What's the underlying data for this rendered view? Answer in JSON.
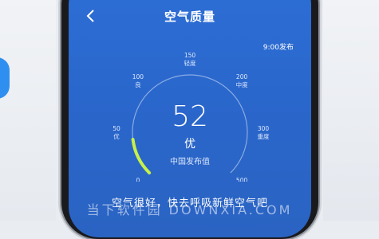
{
  "header": {
    "title": "空气质量",
    "back_icon": "chevron-left-icon"
  },
  "publish_time": "9:00发布",
  "gauge": {
    "ticks": [
      {
        "value": "0",
        "level": "健康"
      },
      {
        "value": "50",
        "level": "优"
      },
      {
        "value": "100",
        "level": "良"
      },
      {
        "value": "150",
        "level": "轻度"
      },
      {
        "value": "200",
        "level": "中度"
      },
      {
        "value": "300",
        "level": "重度"
      },
      {
        "value": "500",
        "level": "严重"
      }
    ],
    "current_value": "52",
    "current_level": "优",
    "source_label": "中国发布值",
    "progress_fraction": 0.14,
    "accent_color": "#c6f04a"
  },
  "tip": "空气很好，快去呼吸新鲜空气吧",
  "watermark": "当下软件园 DOWNXIA.COM"
}
